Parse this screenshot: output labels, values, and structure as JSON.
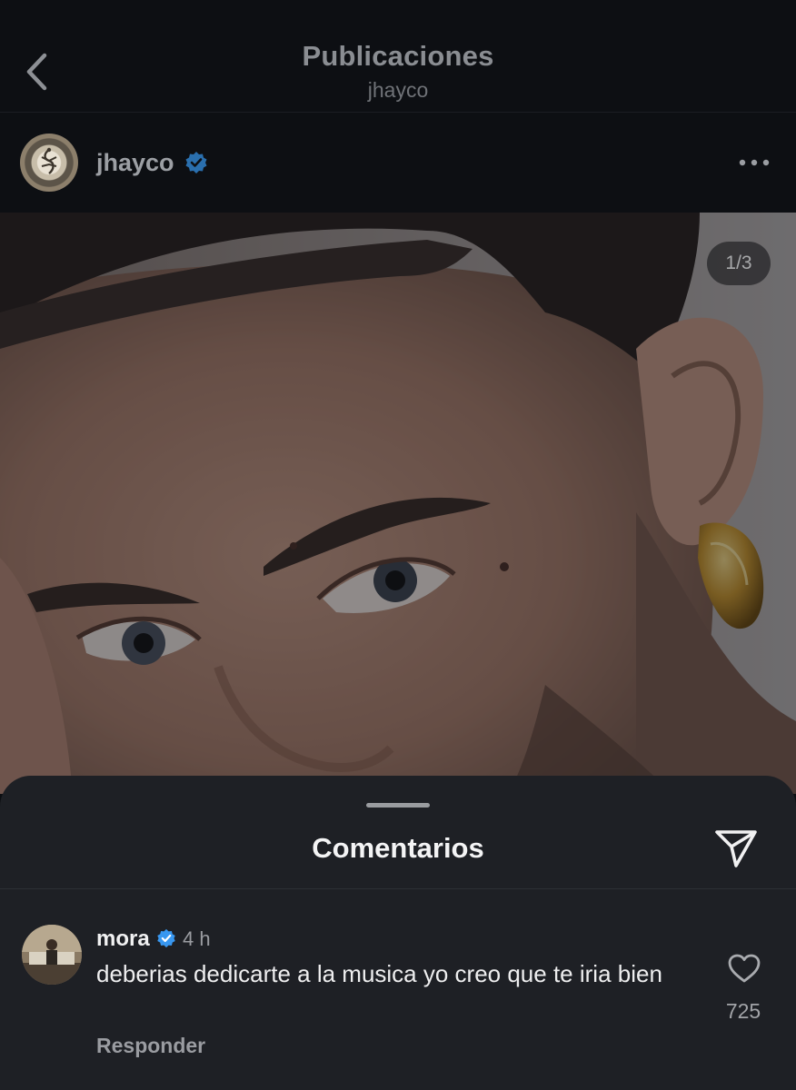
{
  "header": {
    "title": "Publicaciones",
    "subtitle": "jhayco"
  },
  "post": {
    "username": "jhayco",
    "verified": true,
    "image_counter": "1/3"
  },
  "comments_sheet": {
    "title": "Comentarios",
    "comments": [
      {
        "username": "mora",
        "verified": true,
        "time": "4 h",
        "text": "deberias dedicarte a la musica yo creo que te iria bien",
        "reply_label": "Responder",
        "likes": "725"
      }
    ]
  },
  "icons": {
    "back": "chevron-left-icon",
    "verified": "verified-badge-icon",
    "more": "more-horizontal-icon",
    "share": "paper-plane-icon",
    "like": "heart-icon"
  },
  "colors": {
    "verified": "#3897f0",
    "sheet_background": "#1e2025",
    "app_background": "#0c0e12"
  }
}
